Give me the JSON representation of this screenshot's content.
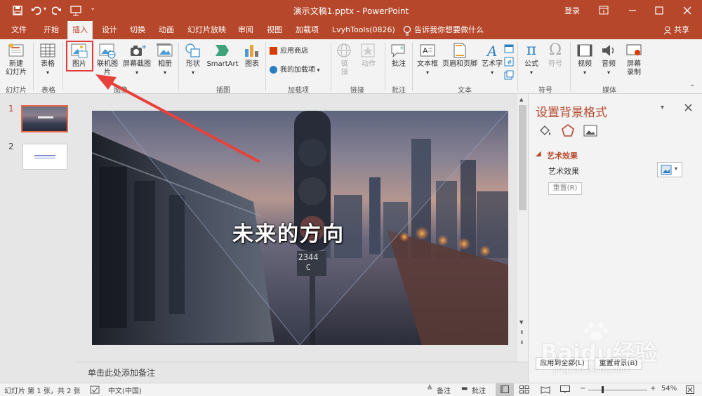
{
  "titlebar": {
    "title": "演示文稿1.pptx - PowerPoint",
    "login_label": "登录"
  },
  "tabs": [
    {
      "label": "文件"
    },
    {
      "label": "开始"
    },
    {
      "label": "插入"
    },
    {
      "label": "设计"
    },
    {
      "label": "切换"
    },
    {
      "label": "动画"
    },
    {
      "label": "幻灯片放映"
    },
    {
      "label": "审阅"
    },
    {
      "label": "视图"
    },
    {
      "label": "加载项"
    },
    {
      "label": "LvyhTools(0826)"
    }
  ],
  "tell_me": "告诉我你想要做什么",
  "share_label": "共享",
  "ribbon": {
    "new_slide_line1": "新建",
    "new_slide_line2": "幻灯片",
    "table": "表格",
    "picture": "图片",
    "online_picture": "联机图片",
    "screenshot": "屏幕截图",
    "album": "相册",
    "shapes": "形状",
    "smartart": "SmartArt",
    "chart": "图表",
    "app_store": "应用商店",
    "my_addins": "我的加载项",
    "link_line1": "链",
    "link_line2": "接",
    "action": "动作",
    "comment": "批注",
    "textbox": "文本框",
    "header_footer": "页眉和页脚",
    "wordart": "艺术字",
    "equation": "公式",
    "symbol": "符号",
    "video": "视频",
    "audio": "音频",
    "screen_rec_line1": "屏幕",
    "screen_rec_line2": "录制",
    "groups": {
      "slides": "幻灯片",
      "tables": "表格",
      "images": "图像",
      "illustrations": "插图",
      "addins": "加载项",
      "links": "链接",
      "comments": "批注",
      "text": "文本",
      "symbols": "符号",
      "media": "媒体"
    }
  },
  "thumbnails": [
    {
      "num": "1"
    },
    {
      "num": "2"
    }
  ],
  "slide": {
    "title": "未来的方向",
    "signal_number": "2344",
    "signal_letter": "C"
  },
  "notes_placeholder": "单击此处添加备注",
  "format_pane": {
    "title": "设置背景格式",
    "section": "艺术效果",
    "artistic_effects_label": "艺术效果",
    "reset_label": "重置(R)",
    "apply_all": "应用到全部(L)",
    "reset_background": "重置背景(B)"
  },
  "status": {
    "slide_info": "幻灯片 第 1 张，共 2 张",
    "language": "中文(中国)",
    "notes": "备注",
    "comments": "批注",
    "zoom": "54%"
  },
  "watermark": {
    "brand": "Baidu经验",
    "url": "jingyan.baidu.com"
  },
  "colors": {
    "accent": "#b7472a",
    "highlight_box": "#e03b3b",
    "arrow": "#e8413c"
  }
}
